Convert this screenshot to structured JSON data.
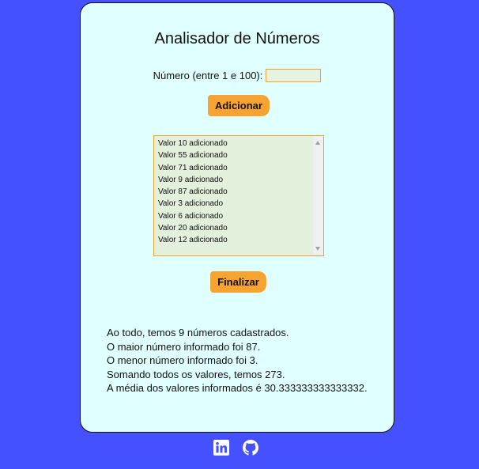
{
  "app": {
    "title": "Analisador de Números"
  },
  "form": {
    "label": "Número (entre 1 e 100):",
    "input_value": "",
    "add_label": "Adicionar",
    "finish_label": "Finalizar"
  },
  "list": {
    "items": [
      "Valor 10 adicionado",
      "Valor 55 adicionado",
      "Valor 71 adicionado",
      "Valor 9 adicionado",
      "Valor 87 adicionado",
      "Valor 3 adicionado",
      "Valor 6 adicionado",
      "Valor 20 adicionado",
      "Valor 12 adicionado"
    ]
  },
  "results": {
    "lines": [
      "Ao todo, temos 9 números cadastrados.",
      "O maior número informado foi 87.",
      "O menor número informado foi 3.",
      "Somando todos os valores, temos 273.",
      "A média dos valores informados é 30.333333333333332."
    ]
  },
  "footer": {
    "icons": [
      "linkedin-icon",
      "github-icon"
    ]
  },
  "colors": {
    "background": "#4550ff",
    "card": "#e0ffff",
    "accent": "#f7a331"
  }
}
